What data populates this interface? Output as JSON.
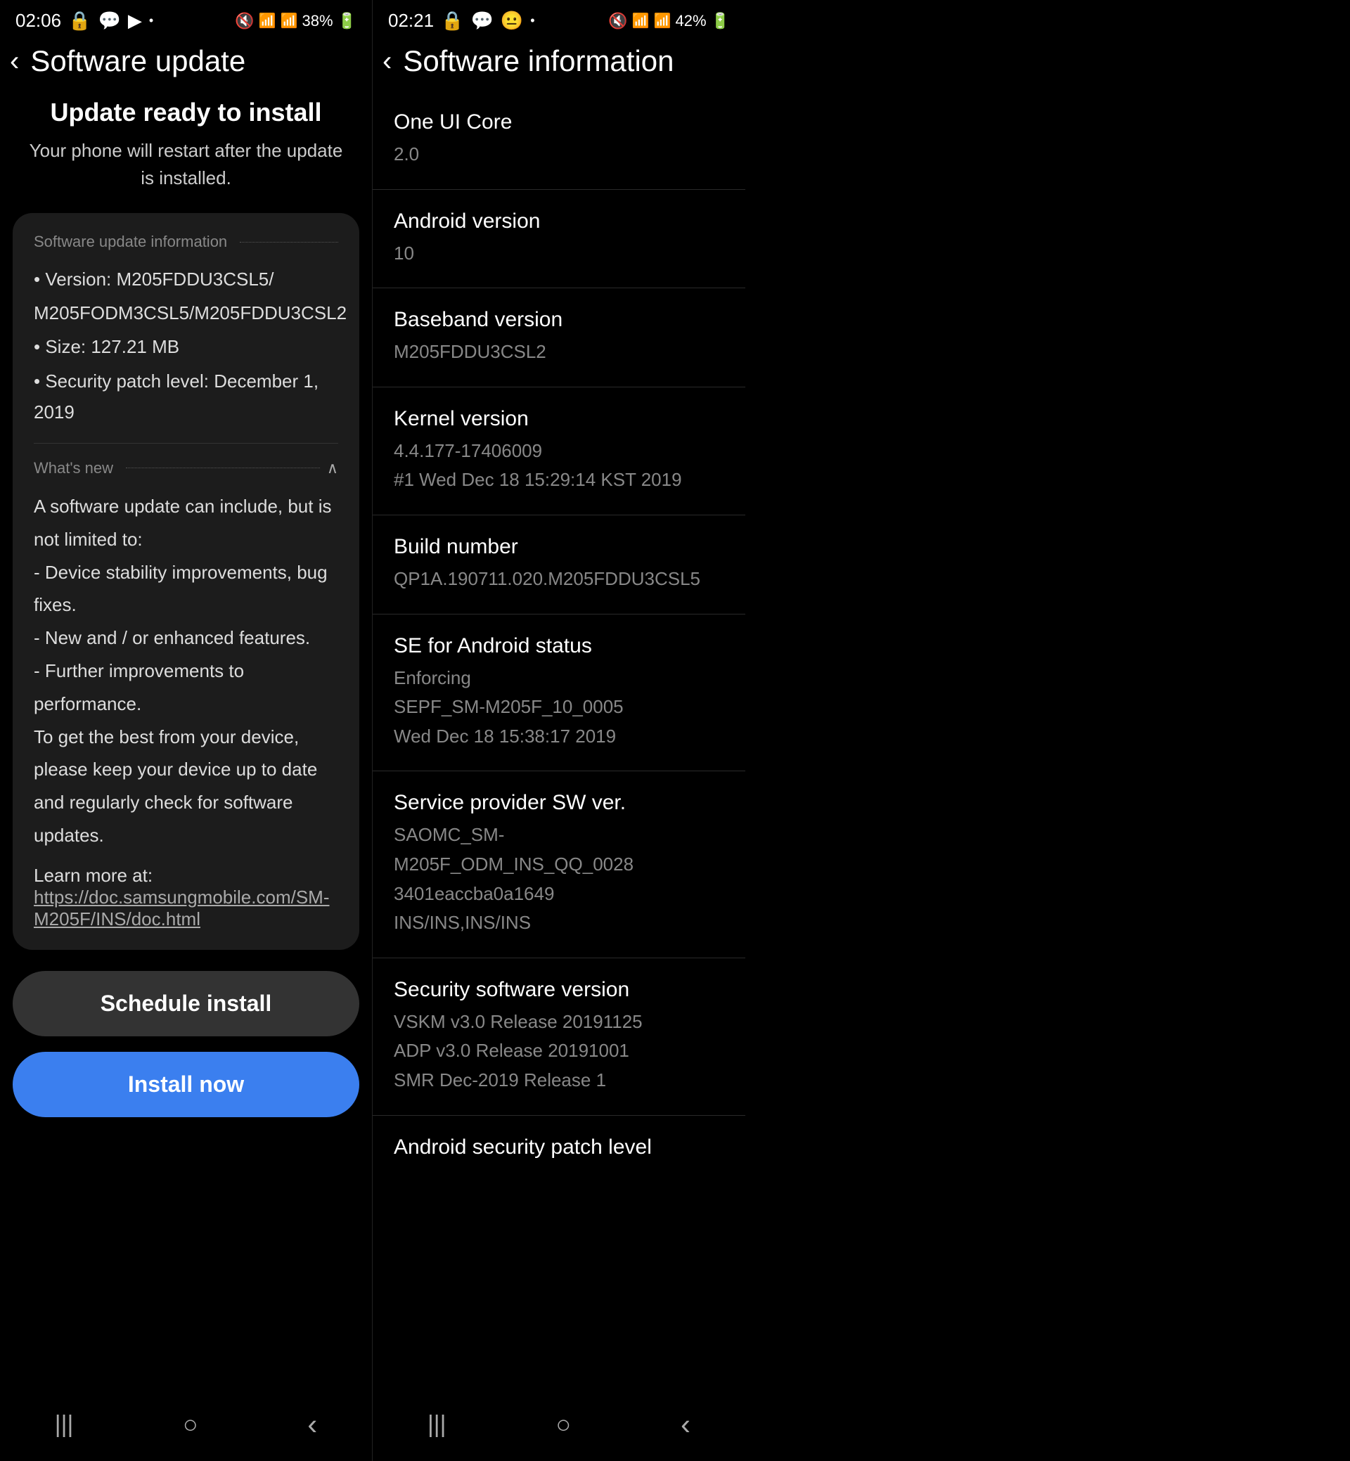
{
  "left": {
    "statusBar": {
      "time": "02:06",
      "battery": "38%"
    },
    "topBar": {
      "back": "‹",
      "title": "Software update"
    },
    "header": {
      "title": "Update ready to install",
      "subtitle": "Your phone will restart after the update is installed."
    },
    "infoCard": {
      "sectionTitle": "Software update information",
      "items": [
        "• Version: M205FDDU3CSL5/",
        "  M205FODM3CSL5/M205FDDU3CSL2",
        "• Size: 127.21 MB",
        "• Security patch level: December 1, 2019"
      ],
      "whatsNew": {
        "title": "What's new",
        "content": "A software update can include, but is not limited to:\n - Device stability improvements, bug fixes.\n - New and / or enhanced features.\n - Further improvements to performance.\nTo get the best from your device, please keep your device up to date and regularly check for software updates."
      },
      "learnMore": "Learn more at:",
      "learnLink": "https://doc.samsungmobile.com/SM-M205F/INS/doc.html"
    },
    "buttons": {
      "schedule": "Schedule install",
      "install": "Install now"
    },
    "navBar": {
      "recents": "|||",
      "home": "○",
      "back": "‹"
    }
  },
  "right": {
    "statusBar": {
      "time": "02:21",
      "battery": "42%"
    },
    "topBar": {
      "back": "‹",
      "title": "Software information"
    },
    "infoRows": [
      {
        "label": "One UI Core",
        "value": "2.0"
      },
      {
        "label": "Android version",
        "value": "10"
      },
      {
        "label": "Baseband version",
        "value": "M205FDDU3CSL2"
      },
      {
        "label": "Kernel version",
        "value": "4.4.177-17406009\n#1 Wed Dec 18 15:29:14 KST 2019"
      },
      {
        "label": "Build number",
        "value": "QP1A.190711.020.M205FDDU3CSL5"
      },
      {
        "label": "SE for Android status",
        "value": "Enforcing\nSEPF_SM-M205F_10_0005\nWed Dec 18 15:38:17 2019"
      },
      {
        "label": "Service provider SW ver.",
        "value": "SAOMC_SM-M205F_ODM_INS_QQ_0028\n3401eaccba0a1649\nINS/INS,INS/INS"
      },
      {
        "label": "Security software version",
        "value": "VSKM v3.0 Release 20191125\nADP v3.0 Release 20191001\nSMR Dec-2019 Release 1"
      }
    ],
    "partialRow": {
      "label": "Android security patch level",
      "value": ""
    },
    "navBar": {
      "recents": "|||",
      "home": "○",
      "back": "‹"
    }
  }
}
